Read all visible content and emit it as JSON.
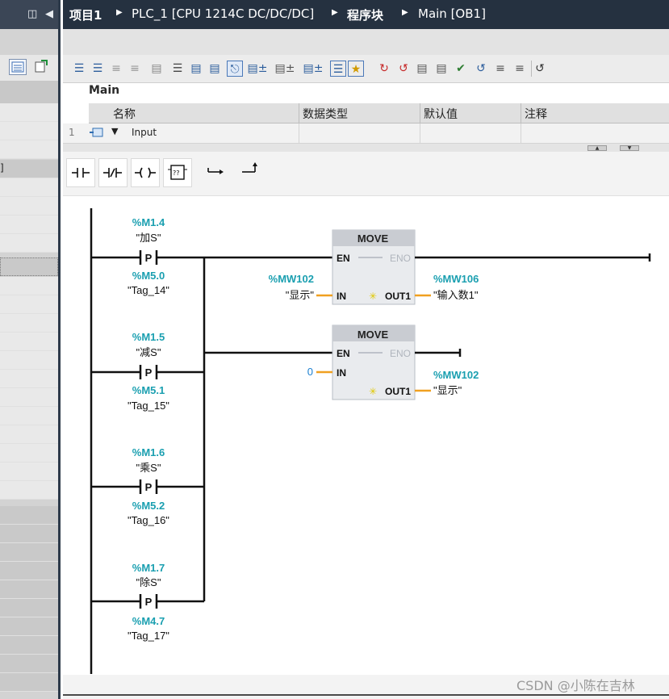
{
  "breadcrumb": {
    "items": [
      "项目1",
      "PLC_1 [CPU 1214C DC/DC/DC]",
      "程序块",
      "Main [OB1]"
    ]
  },
  "interface": {
    "block_name": "Main",
    "columns": [
      "名称",
      "数据类型",
      "默认值",
      "注释"
    ],
    "rows": [
      {
        "index": "1",
        "name": "Input"
      }
    ]
  },
  "lad_instructions": [
    {
      "name": "no-contact"
    },
    {
      "name": "nc-contact"
    },
    {
      "name": "coil"
    },
    {
      "name": "empty-box"
    },
    {
      "name": "open-branch"
    },
    {
      "name": "close-branch"
    }
  ],
  "network": {
    "contacts": [
      {
        "address": "%M1.4",
        "symbol": "\"加S\"",
        "edge_type": "P",
        "edge_address": "%M5.0",
        "edge_symbol": "\"Tag_14\""
      },
      {
        "address": "%M1.5",
        "symbol": "\"减S\"",
        "edge_type": "P",
        "edge_address": "%M5.1",
        "edge_symbol": "\"Tag_15\""
      },
      {
        "address": "%M1.6",
        "symbol": "\"乘S\"",
        "edge_type": "P",
        "edge_address": "%M5.2",
        "edge_symbol": "\"Tag_16\""
      },
      {
        "address": "%M1.7",
        "symbol": "\"除S\"",
        "edge_type": "P",
        "edge_address": "%M4.7",
        "edge_symbol": "\"Tag_17\""
      }
    ],
    "move_blocks": [
      {
        "title": "MOVE",
        "en": "EN",
        "eno": "ENO",
        "in_label": "IN",
        "out_label": "OUT1",
        "in_address": "%MW102",
        "in_symbol": "\"显示\"",
        "out_address": "%MW106",
        "out_symbol": "\"输入数1\""
      },
      {
        "title": "MOVE",
        "en": "EN",
        "eno": "ENO",
        "in_label": "IN",
        "out_label": "OUT1",
        "in_value": "0",
        "out_address": "%MW102",
        "out_symbol": "\"显示\""
      }
    ]
  },
  "colors": {
    "title_bg": "#253140",
    "address_teal": "#1a9fb0",
    "wire_orange": "#f0a020",
    "move_header": "#c9ccd2",
    "move_body": "#e9ebee",
    "highlight_icon": "#f2d600"
  },
  "watermark": "CSDN @小陈在吉林"
}
